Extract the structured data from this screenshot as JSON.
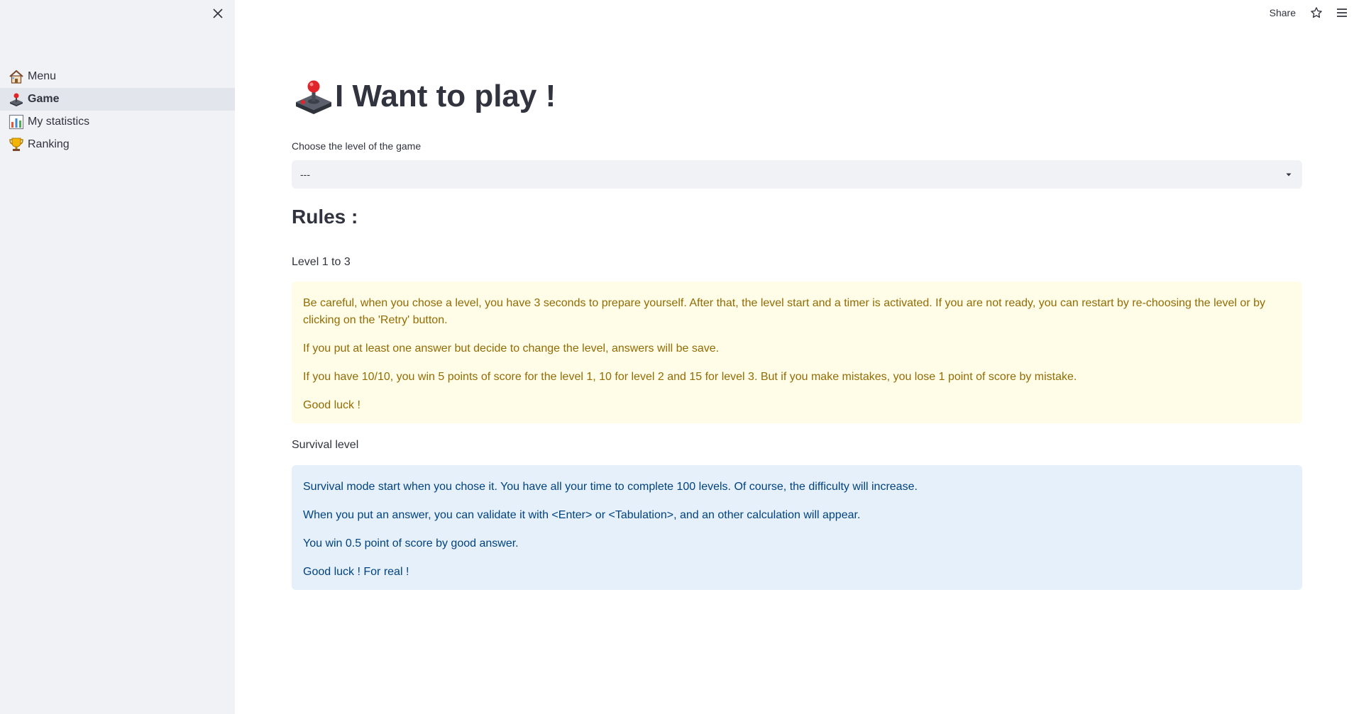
{
  "sidebar": {
    "items": [
      {
        "label": "Menu",
        "icon": "house-icon",
        "active": false
      },
      {
        "label": "Game",
        "icon": "joystick-icon",
        "active": true
      },
      {
        "label": "My statistics",
        "icon": "bar-chart-icon",
        "active": false
      },
      {
        "label": "Ranking",
        "icon": "trophy-icon",
        "active": false
      }
    ]
  },
  "header": {
    "share_label": "Share"
  },
  "main": {
    "title": "I Want to play !",
    "title_icon": "joystick-icon",
    "select": {
      "label": "Choose the level of the game",
      "value": "---"
    },
    "rules_heading": "Rules :",
    "level_label": "Level 1 to 3",
    "warning": {
      "p1": "Be careful, when you chose a level, you have 3 seconds to prepare yourself. After that, the level start and a timer is activated. If you are not ready, you can restart by re-choosing the level or by clicking on the 'Retry' button.",
      "p2": "If you put at least one answer but decide to change the level, answers will be save.",
      "p3": "If you have 10/10, you win 5 points of score for the level 1, 10 for level 2 and 15 for level 3. But if you make mistakes, you lose 1 point of score by mistake.",
      "p4": "Good luck !"
    },
    "survival_label": "Survival level",
    "info": {
      "p1": "Survival mode start when you chose it. You have all your time to complete 100 levels. Of course, the difficulty will increase.",
      "p2": "When you put an answer, you can validate it with <Enter> or <Tabulation>, and an other calculation will appear.",
      "p3": "You win 0.5 point of score by good answer.",
      "p4": "Good luck ! For real !"
    }
  },
  "colors": {
    "sidebar_bg": "#f0f2f6",
    "active_item_bg": "#e2e5eb",
    "warning_bg": "#fffce7",
    "warning_text": "#926c05",
    "info_bg": "#e6f0fa",
    "info_text": "#004280",
    "text": "#31333f"
  }
}
